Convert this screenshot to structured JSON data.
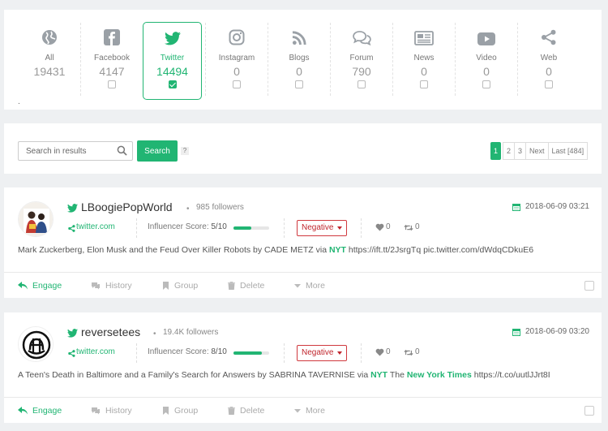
{
  "sources": [
    {
      "label": "All",
      "count": "19431",
      "icon": "globe-icon",
      "checkbox": false
    },
    {
      "label": "Facebook",
      "count": "4147",
      "icon": "facebook-icon",
      "checkbox": true
    },
    {
      "label": "Twitter",
      "count": "14494",
      "icon": "twitter-icon",
      "checkbox": true,
      "active": true
    },
    {
      "label": "Instagram",
      "count": "0",
      "icon": "instagram-icon",
      "checkbox": true
    },
    {
      "label": "Blogs",
      "count": "0",
      "icon": "rss-icon",
      "checkbox": true
    },
    {
      "label": "Forum",
      "count": "790",
      "icon": "forum-icon",
      "checkbox": true
    },
    {
      "label": "News",
      "count": "0",
      "icon": "newspaper-icon",
      "checkbox": true
    },
    {
      "label": "Video",
      "count": "0",
      "icon": "video-icon",
      "checkbox": true
    },
    {
      "label": "Web",
      "count": "0",
      "icon": "share-icon",
      "checkbox": true
    }
  ],
  "sources_footer_mark": ".",
  "search": {
    "placeholder": "Search in results",
    "button": "Search",
    "help": "?"
  },
  "pagination": {
    "pages": [
      "1",
      "2",
      "3"
    ],
    "next": "Next",
    "last": "Last [484]",
    "current": "1"
  },
  "posts": [
    {
      "username": "LBoogiePopWorld",
      "bullet": "•",
      "followers": "985  followers",
      "date": "2018-06-09 03:21",
      "domain": "twitter.com",
      "influencer_label": "Influencer Score: ",
      "influencer_score": "5/10",
      "influencer_fraction": 0.5,
      "sentiment": "Negative",
      "likes": "0",
      "retweets": "0",
      "text_parts": [
        "Mark Zuckerberg, Elon Musk and the Feud Over Killer Robots by CADE METZ via ",
        "NYT",
        " https://ift.tt/2JsrgTq pic.twitter.com/dWdqCDkuE6"
      ]
    },
    {
      "username": "reversetees",
      "bullet": "•",
      "followers": "19.4K  followers",
      "date": "2018-06-09 03:20",
      "domain": "twitter.com",
      "influencer_label": "Influencer Score: ",
      "influencer_score": "8/10",
      "influencer_fraction": 0.8,
      "sentiment": "Negative",
      "likes": "0",
      "retweets": "0",
      "text_parts": [
        "A Teen's Death in Baltimore and a Family's Search for Answers by SABRINA TAVERNISE via ",
        "NYT",
        " The ",
        "New York Times",
        " https://t.co/uutlJJrt8I"
      ]
    }
  ],
  "actions": {
    "engage": "Engage",
    "history": "History",
    "group": "Group",
    "delete": "Delete",
    "more": "More"
  },
  "colors": {
    "accent": "#21b573",
    "negative": "#c0252c",
    "twitter": "#1da1f2"
  }
}
